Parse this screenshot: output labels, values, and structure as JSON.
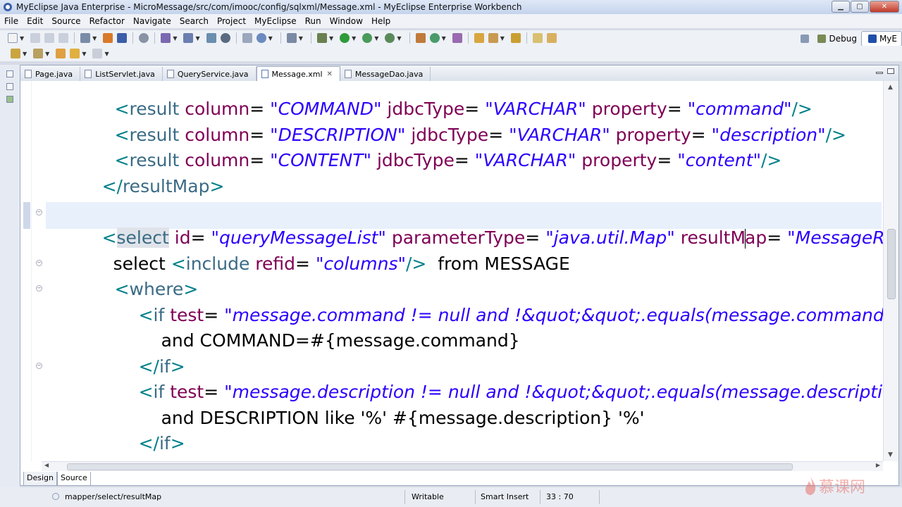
{
  "window": {
    "title": "MyEclipse Java Enterprise - MicroMessage/src/com/imooc/config/sqlxml/Message.xml - MyEclipse Enterprise Workbench",
    "minimize": "▁",
    "maximize": "▢",
    "close": "✕"
  },
  "menu": {
    "items": [
      "File",
      "Edit",
      "Source",
      "Refactor",
      "Navigate",
      "Search",
      "Project",
      "MyEclipse",
      "Run",
      "Window",
      "Help"
    ]
  },
  "perspectives": {
    "debug": "Debug",
    "myeclipse": "MyE"
  },
  "tabs": [
    {
      "label": "Page.java",
      "active": false
    },
    {
      "label": "ListServlet.java",
      "active": false
    },
    {
      "label": "QueryService.java",
      "active": false
    },
    {
      "label": "Message.xml",
      "active": true
    },
    {
      "label": "MessageDao.java",
      "active": false
    }
  ],
  "tab_close_glyph": "✕",
  "code": {
    "l1": {
      "open": "<",
      "tag": "result",
      "a1": " column",
      "eq1": "= ",
      "v1": "\"COMMAND\"",
      "a2": " jdbcType",
      "eq2": "= ",
      "v2": "\"VARCHAR\"",
      "a3": " property",
      "eq3": "= ",
      "v3": "\"command\"",
      "close": "/>"
    },
    "l2": {
      "open": "<",
      "tag": "result",
      "a1": " column",
      "eq1": "= ",
      "v1": "\"DESCRIPTION\"",
      "a2": " jdbcType",
      "eq2": "= ",
      "v2": "\"VARCHAR\"",
      "a3": " property",
      "eq3": "= ",
      "v3": "\"description\"",
      "close": "/>"
    },
    "l3": {
      "open": "<",
      "tag": "result",
      "a1": " column",
      "eq1": "= ",
      "v1": "\"CONTENT\"",
      "a2": " jdbcType",
      "eq2": "= ",
      "v2": "\"VARCHAR\"",
      "a3": " property",
      "eq3": "= ",
      "v3": "\"content\"",
      "close": "/>"
    },
    "l4": {
      "open": "</",
      "tag": "resultMap",
      "close": ">"
    },
    "l5": {
      "open": "<",
      "tag": "select",
      "a1": " id",
      "eq1": "= ",
      "v1": "\"queryMessageList\"",
      "a2": " parameterType",
      "eq2": "= ",
      "v2": "\"java.util.Map\"",
      "a3a": " resultM",
      "a3b": "ap",
      "eq3": "= ",
      "v3": "\"MessageResu"
    },
    "l6": {
      "pre": "select ",
      "open": "<",
      "tag": "include",
      "a1": " refid",
      "eq1": "= ",
      "v1": "\"columns\"",
      "close": "/>",
      "post": "  from MESSAGE"
    },
    "l7": {
      "open": "<",
      "tag": "where",
      "close": ">"
    },
    "l8": {
      "open": "<",
      "tag": "if",
      "a1": " test",
      "eq1": "= ",
      "v1": "\"message.command != null and !&quot;&quot;.equals(message.command.tri"
    },
    "l9": {
      "text": "and COMMAND=#{message.command}"
    },
    "l10": {
      "open": "</",
      "tag": "if",
      "close": ">"
    },
    "l11": {
      "open": "<",
      "tag": "if",
      "a1": " test",
      "eq1": "= ",
      "v1": "\"message.description != null and !&quot;&quot;.equals(message.description."
    },
    "l12": {
      "text": "and DESCRIPTION like '%' #{message.description} '%'"
    },
    "l13": {
      "open": "</",
      "tag": "if",
      "close": ">"
    },
    "l14": {
      "open": "</",
      "tag": "where",
      "close": ">"
    }
  },
  "view_tabs": {
    "design": "Design",
    "source": "Source"
  },
  "status": {
    "path": "mapper/select/resultMap",
    "writable": "Writable",
    "insert_mode": "Smart Insert",
    "position": "33 : 70"
  },
  "watermark": {
    "text": "慕课网"
  },
  "colors": {
    "tag": "#3a6b85",
    "attribute": "#7f0055",
    "value": "#2a00ff",
    "bracket": "#00808a",
    "current_line": "#e8f0fc"
  }
}
